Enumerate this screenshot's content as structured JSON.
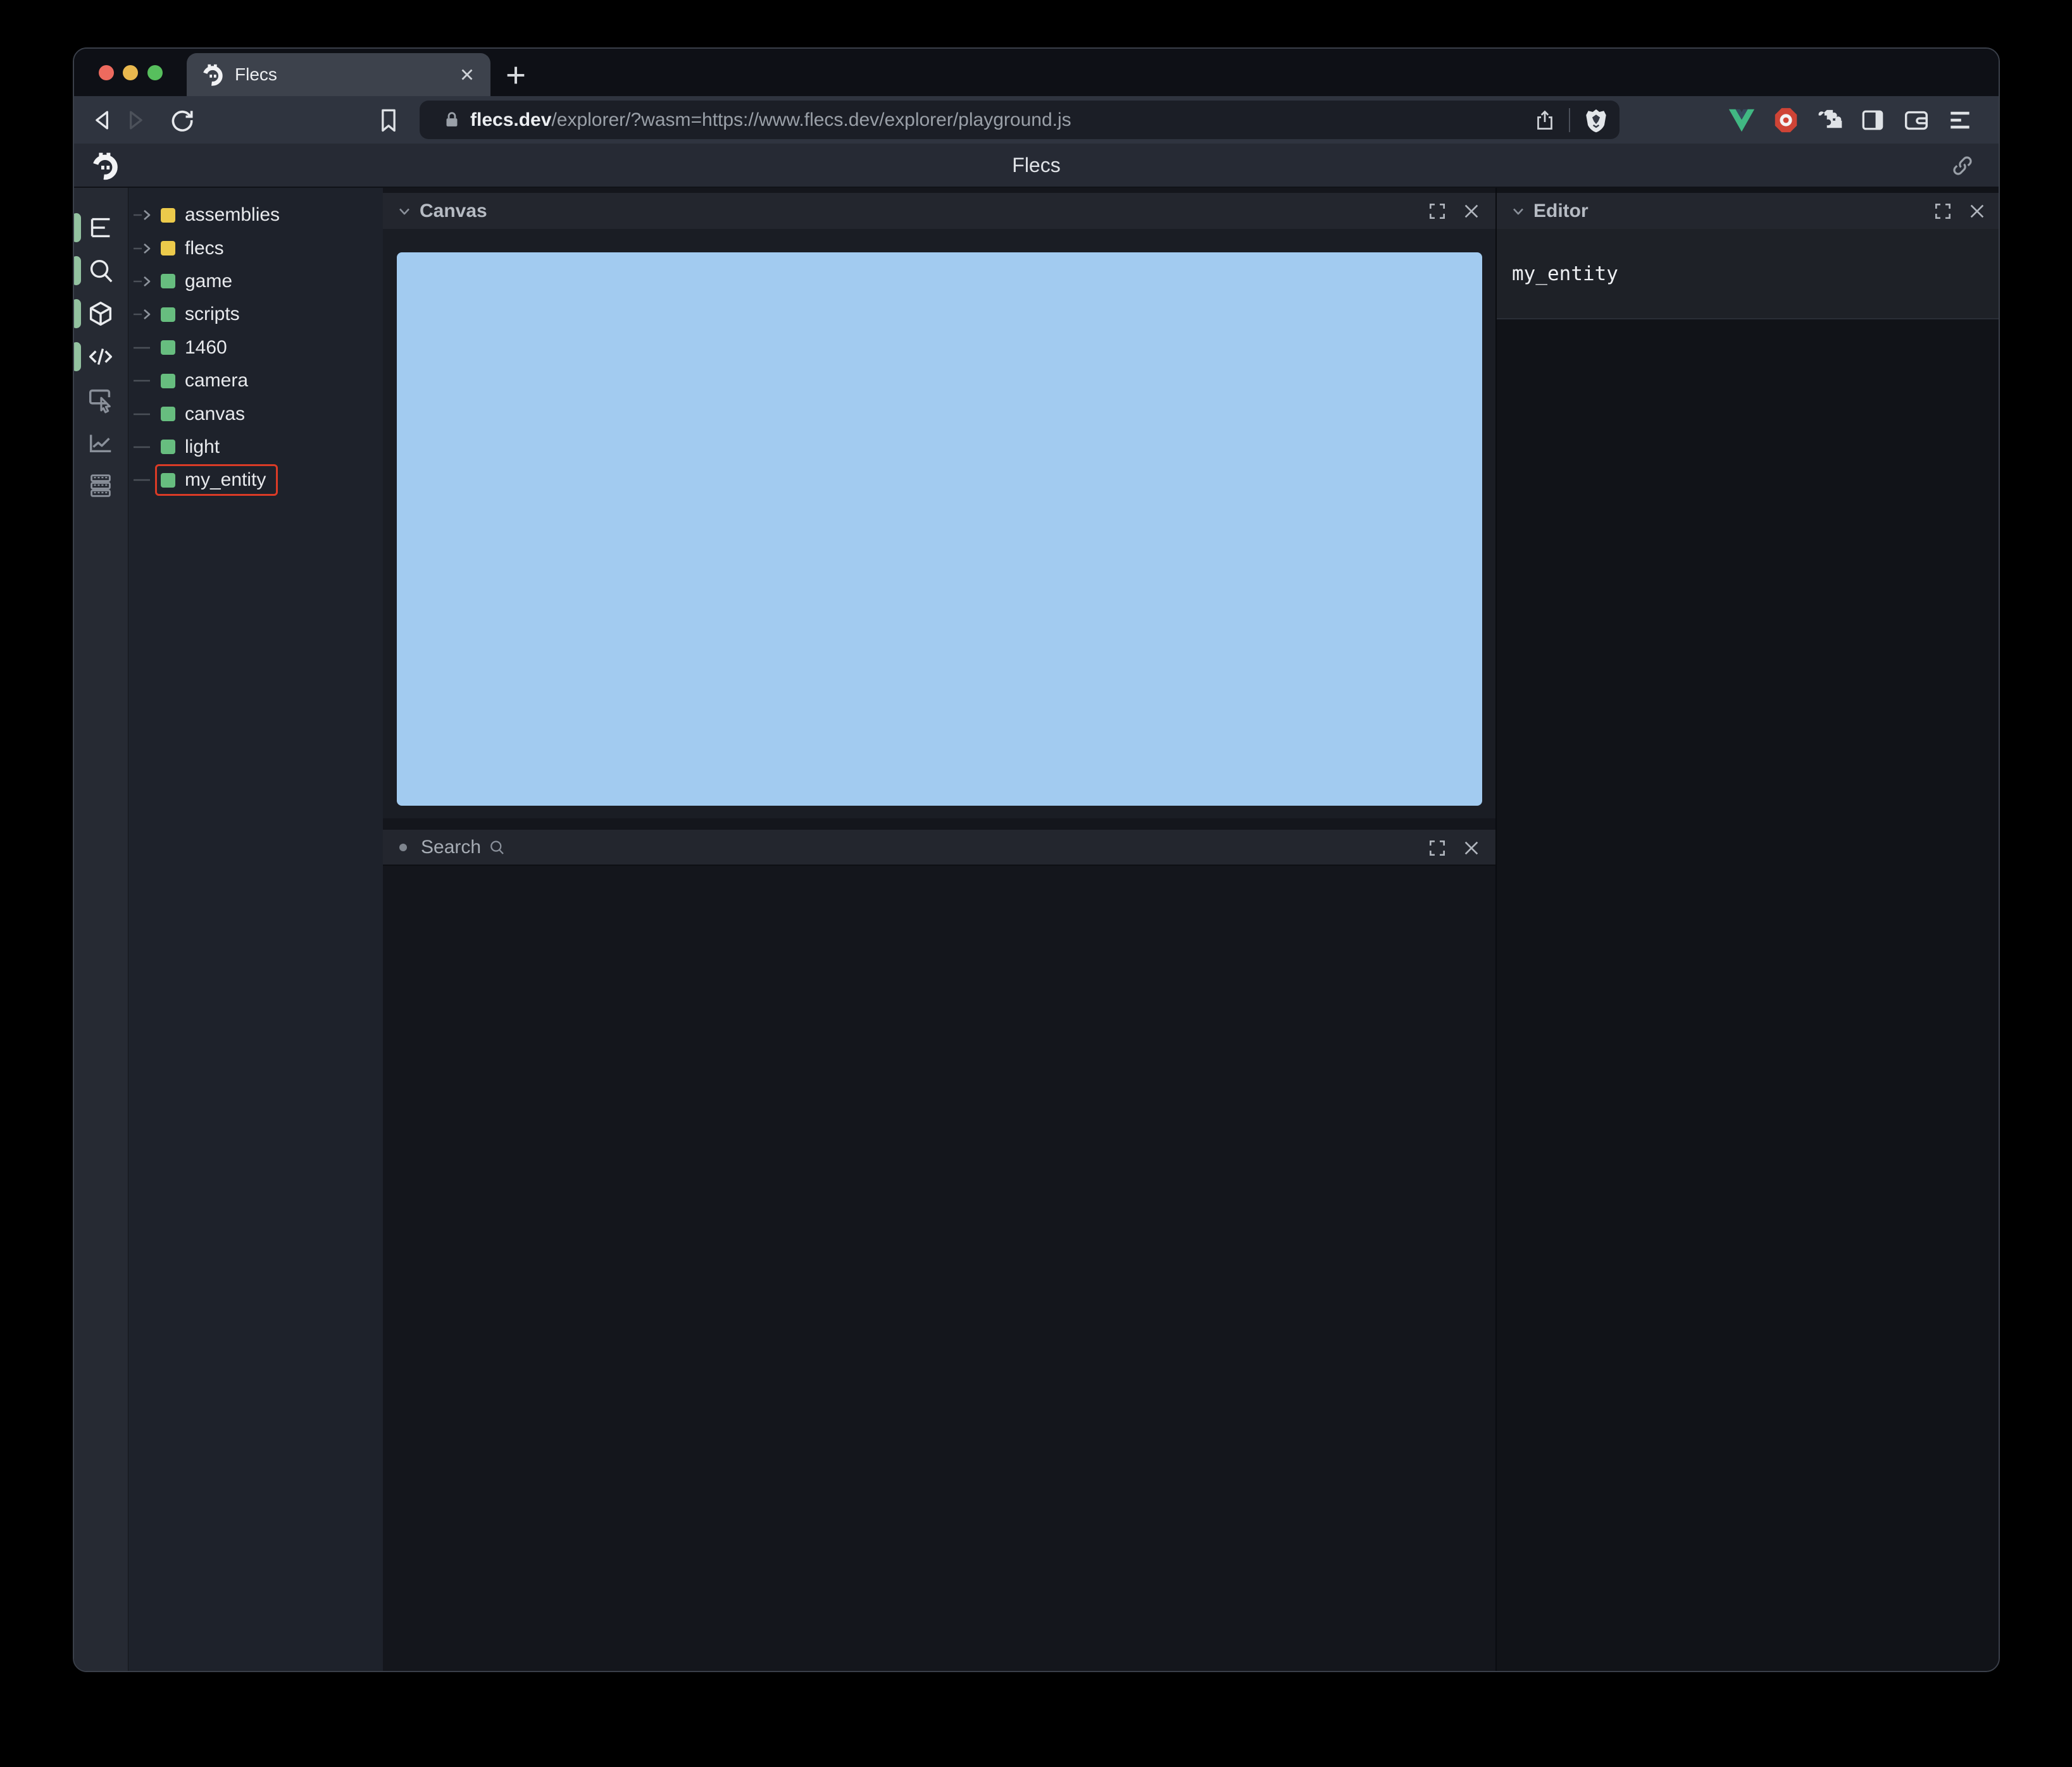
{
  "browser": {
    "tab_title": "Flecs",
    "url_host": "flecs.dev",
    "url_path": "/explorer/?wasm=https://www.flecs.dev/explorer/playground.js"
  },
  "app": {
    "title": "Flecs",
    "colors": {
      "canvas_blue": "#a2cbf0",
      "selection_red": "#da3b26",
      "entity_green": "#67bd7f",
      "module_yellow": "#ecca4b"
    },
    "tree": {
      "items": [
        {
          "label": "assemblies",
          "color": "#ecca4b",
          "expandable": true,
          "selected": false
        },
        {
          "label": "flecs",
          "color": "#ecca4b",
          "expandable": true,
          "selected": false
        },
        {
          "label": "game",
          "color": "#67bd7f",
          "expandable": true,
          "selected": false
        },
        {
          "label": "scripts",
          "color": "#67bd7f",
          "expandable": true,
          "selected": false
        },
        {
          "label": "1460",
          "color": "#67bd7f",
          "expandable": false,
          "selected": false
        },
        {
          "label": "camera",
          "color": "#67bd7f",
          "expandable": false,
          "selected": false
        },
        {
          "label": "canvas",
          "color": "#67bd7f",
          "expandable": false,
          "selected": false
        },
        {
          "label": "light",
          "color": "#67bd7f",
          "expandable": false,
          "selected": false
        },
        {
          "label": "my_entity",
          "color": "#67bd7f",
          "expandable": false,
          "selected": true
        }
      ]
    },
    "panels": {
      "canvas": {
        "title": "Canvas"
      },
      "search": {
        "title": "Search"
      },
      "editor": {
        "title": "Editor",
        "content": "my_entity"
      }
    }
  }
}
